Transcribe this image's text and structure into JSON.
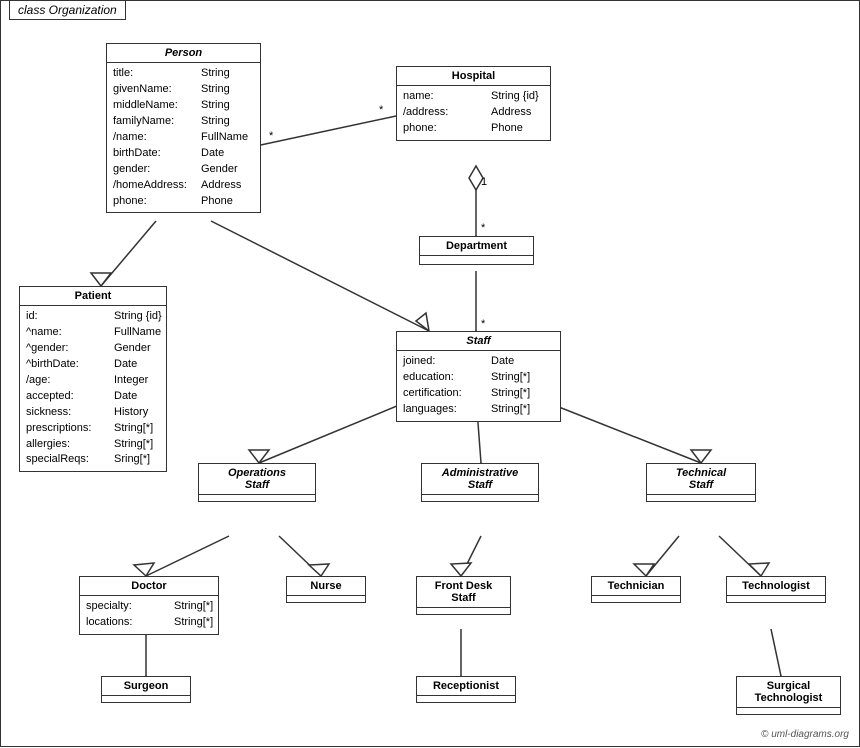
{
  "title": "class Organization",
  "copyright": "© uml-diagrams.org",
  "classes": {
    "person": {
      "name": "Person",
      "italic": true,
      "attributes": [
        {
          "name": "title:",
          "type": "String"
        },
        {
          "name": "givenName:",
          "type": "String"
        },
        {
          "name": "middleName:",
          "type": "String"
        },
        {
          "name": "familyName:",
          "type": "String"
        },
        {
          "name": "/name:",
          "type": "FullName"
        },
        {
          "name": "birthDate:",
          "type": "Date"
        },
        {
          "name": "gender:",
          "type": "Gender"
        },
        {
          "name": "/homeAddress:",
          "type": "Address"
        },
        {
          "name": "phone:",
          "type": "Phone"
        }
      ]
    },
    "hospital": {
      "name": "Hospital",
      "italic": false,
      "attributes": [
        {
          "name": "name:",
          "type": "String {id}"
        },
        {
          "name": "/address:",
          "type": "Address"
        },
        {
          "name": "phone:",
          "type": "Phone"
        }
      ]
    },
    "department": {
      "name": "Department",
      "italic": false,
      "attributes": []
    },
    "staff": {
      "name": "Staff",
      "italic": true,
      "attributes": [
        {
          "name": "joined:",
          "type": "Date"
        },
        {
          "name": "education:",
          "type": "String[*]"
        },
        {
          "name": "certification:",
          "type": "String[*]"
        },
        {
          "name": "languages:",
          "type": "String[*]"
        }
      ]
    },
    "patient": {
      "name": "Patient",
      "italic": false,
      "attributes": [
        {
          "name": "id:",
          "type": "String {id}"
        },
        {
          "name": "^name:",
          "type": "FullName"
        },
        {
          "name": "^gender:",
          "type": "Gender"
        },
        {
          "name": "^birthDate:",
          "type": "Date"
        },
        {
          "name": "/age:",
          "type": "Integer"
        },
        {
          "name": "accepted:",
          "type": "Date"
        },
        {
          "name": "sickness:",
          "type": "History"
        },
        {
          "name": "prescriptions:",
          "type": "String[*]"
        },
        {
          "name": "allergies:",
          "type": "String[*]"
        },
        {
          "name": "specialReqs:",
          "type": "Sring[*]"
        }
      ]
    },
    "operations_staff": {
      "name": "Operations\nStaff",
      "italic": true,
      "attributes": []
    },
    "administrative_staff": {
      "name": "Administrative\nStaff",
      "italic": true,
      "attributes": []
    },
    "technical_staff": {
      "name": "Technical\nStaff",
      "italic": true,
      "attributes": []
    },
    "doctor": {
      "name": "Doctor",
      "italic": false,
      "attributes": [
        {
          "name": "specialty:",
          "type": "String[*]"
        },
        {
          "name": "locations:",
          "type": "String[*]"
        }
      ]
    },
    "nurse": {
      "name": "Nurse",
      "italic": false,
      "attributes": []
    },
    "front_desk_staff": {
      "name": "Front Desk\nStaff",
      "italic": false,
      "attributes": []
    },
    "technician": {
      "name": "Technician",
      "italic": false,
      "attributes": []
    },
    "technologist": {
      "name": "Technologist",
      "italic": false,
      "attributes": []
    },
    "surgeon": {
      "name": "Surgeon",
      "italic": false,
      "attributes": []
    },
    "receptionist": {
      "name": "Receptionist",
      "italic": false,
      "attributes": []
    },
    "surgical_technologist": {
      "name": "Surgical\nTechnologist",
      "italic": false,
      "attributes": []
    }
  }
}
